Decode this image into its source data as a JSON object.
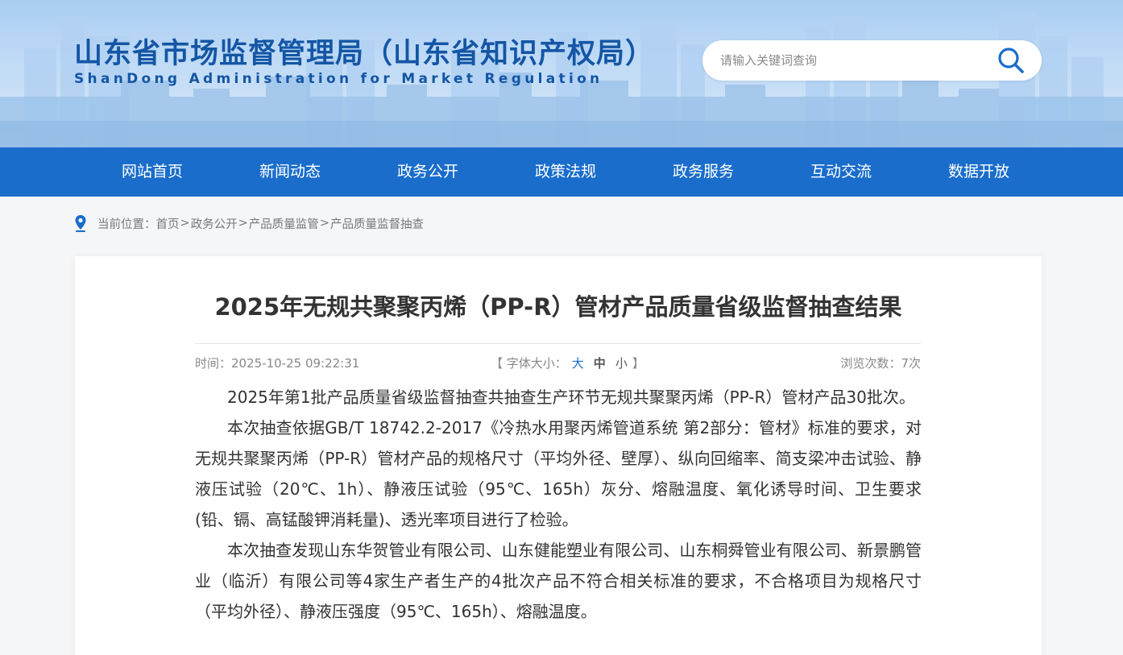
{
  "header": {
    "title": "山东省市场监督管理局（山东省知识产权局）",
    "subtitle": "ShanDong Administration for Market Regulation",
    "search": {
      "placeholder": "请输入关键词查询",
      "icon": "search-icon"
    }
  },
  "nav": {
    "items": [
      {
        "label": "网站首页"
      },
      {
        "label": "新闻动态"
      },
      {
        "label": "政务公开"
      },
      {
        "label": "政策法规"
      },
      {
        "label": "政务服务"
      },
      {
        "label": "互动交流"
      },
      {
        "label": "数据开放"
      }
    ]
  },
  "breadcrumb": {
    "prefix": "当前位置：",
    "items": [
      "首页",
      "政务公开",
      "产品质量监管",
      "产品质量监督抽查"
    ],
    "separator": ">"
  },
  "article": {
    "title": "2025年无规共聚聚丙烯（PP-R）管材产品质量省级监督抽查结果",
    "time": "时间：2025-10-25 09:22:31",
    "font_size": {
      "open": "【 字体大小：",
      "large": "大",
      "medium": "中",
      "small": "小",
      "close": "】"
    },
    "views": "浏览次数：7次",
    "paragraphs": [
      "2025年第1批产品质量省级监督抽查共抽查生产环节无规共聚聚丙烯（PP-R）管材产品30批次。",
      "本次抽查依据GB/T 18742.2-2017《冷热水用聚丙烯管道系统 第2部分：管材》标准的要求，对无规共聚聚丙烯（PP-R）管材产品的规格尺寸（平均外径、壁厚）、纵向回缩率、简支梁冲击试验、静液压试验（20℃、1h）、静液压试验（95℃、165h）灰分、熔融温度、氧化诱导时间、卫生要求(铅、镉、高锰酸钾消耗量)、透光率项目进行了检验。",
      "本次抽查发现山东华贺管业有限公司、山东健能塑业有限公司、山东桐舜管业有限公司、新景鹏管业（临沂）有限公司等4家生产者生产的4批次产品不符合相关标准的要求，不合格项目为规格尺寸（平均外径）、静液压强度（95℃、165h）、熔融温度。"
    ]
  },
  "colors": {
    "brand_blue": "#1a6dcb",
    "title_blue": "#1456a5",
    "banner_light": "#c2dcf6"
  }
}
